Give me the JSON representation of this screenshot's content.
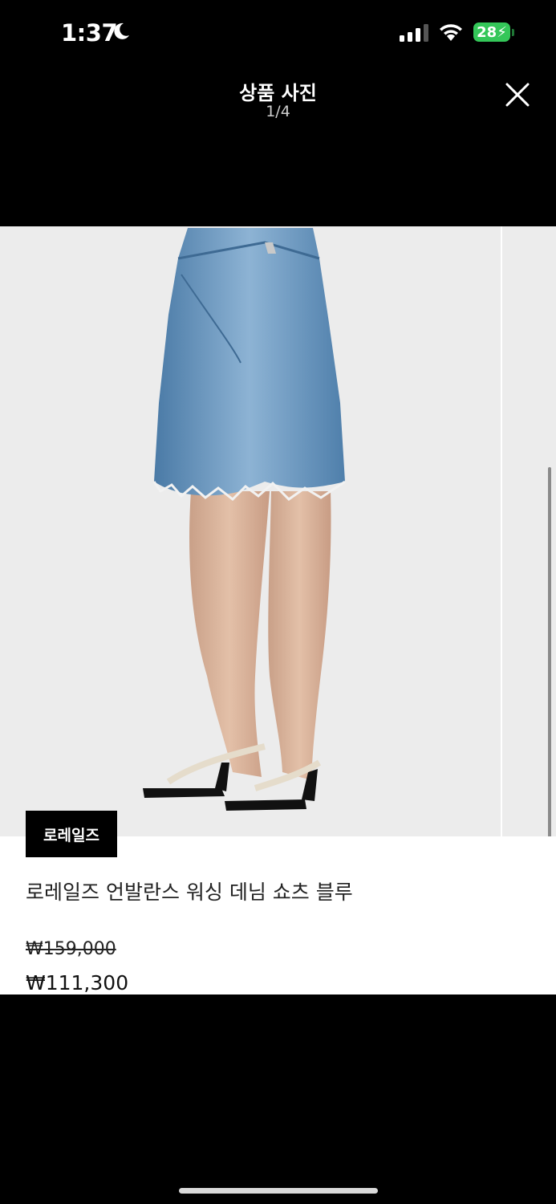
{
  "status_bar": {
    "time": "1:37",
    "battery": "28"
  },
  "header": {
    "title": "상품 사진",
    "counter": "1/4"
  },
  "product": {
    "brand": "로레일즈",
    "name": "로레일즈 언발란스 워싱 데님 쇼츠 블루",
    "original_price": "₩159,000",
    "sale_price": "₩111,300"
  },
  "colors": {
    "battery": "#34c759",
    "image_bg": "#ececec",
    "denim": "#5f8fb8"
  }
}
